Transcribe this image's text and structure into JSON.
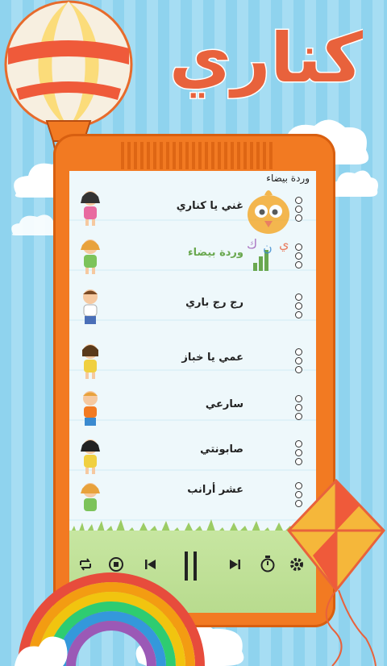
{
  "app": {
    "logo_text": "كناري"
  },
  "screen": {
    "header_title": "وردة بيضاء",
    "songs": [
      {
        "title": "غني يا كناري",
        "playing": false
      },
      {
        "title": "وردة بيضاء",
        "playing": true
      },
      {
        "title": "رج رج باري",
        "playing": false
      },
      {
        "title": "عمي يا خباز",
        "playing": false
      },
      {
        "title": "سارعي",
        "playing": false
      },
      {
        "title": "صابونتي",
        "playing": false
      },
      {
        "title": "عشر أرانب",
        "playing": false
      }
    ]
  },
  "player": {
    "controls": [
      "repeat-icon",
      "stop-icon",
      "previous-icon",
      "pause-icon",
      "next-icon",
      "timer-icon",
      "settings-icon"
    ]
  },
  "colors": {
    "tablet": "#f27a22",
    "playing": "#6aa84f",
    "player_bar": "#c7e6a1",
    "background": "#8fd3ee"
  }
}
